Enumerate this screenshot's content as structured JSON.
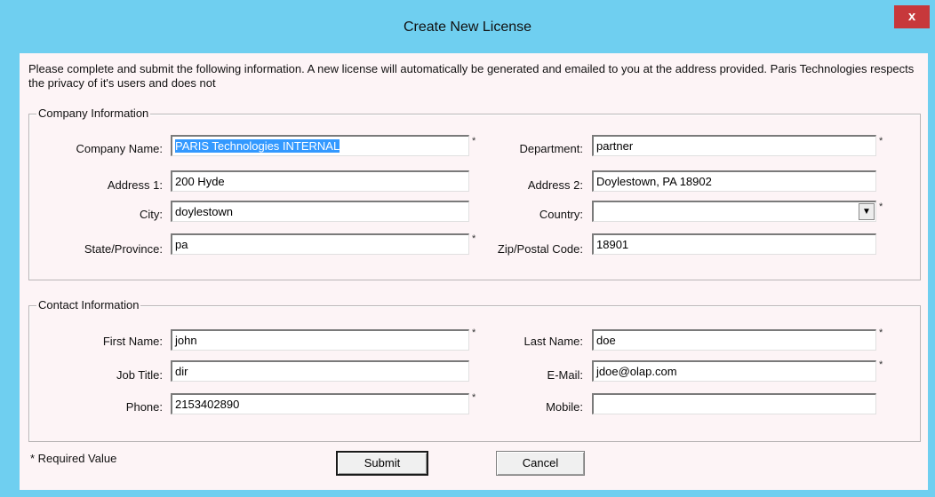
{
  "window": {
    "title": "Create New License",
    "close_label": "x"
  },
  "intro_text": "Please complete and submit the following information.  A new license will automatically be generated and emailed to you at the address provided.  Paris Technologies respects the privacy of it's users and does not",
  "company": {
    "group_title": "Company Information",
    "company_name": {
      "label": "Company Name:",
      "value": "PARIS Technologies INTERNAL"
    },
    "department": {
      "label": "Department:",
      "value": "partner"
    },
    "address1": {
      "label": "Address 1:",
      "value": "200 Hyde"
    },
    "address2": {
      "label": "Address 2:",
      "value": "Doylestown, PA 18902"
    },
    "city": {
      "label": "City:",
      "value": "doylestown"
    },
    "country": {
      "label": "Country:",
      "value": ""
    },
    "state": {
      "label": "State/Province:",
      "value": "pa"
    },
    "zip": {
      "label": "Zip/Postal Code:",
      "value": "18901"
    }
  },
  "contact": {
    "group_title": "Contact Information",
    "first_name": {
      "label": "First Name:",
      "value": "john"
    },
    "last_name": {
      "label": "Last Name:",
      "value": "doe"
    },
    "job_title": {
      "label": "Job Title:",
      "value": "dir"
    },
    "email": {
      "label": "E-Mail:",
      "value": "jdoe@olap.com"
    },
    "phone": {
      "label": "Phone:",
      "value": "2153402890"
    },
    "mobile": {
      "label": "Mobile:",
      "value": ""
    }
  },
  "required_marker": "*",
  "required_note": "* Required Value",
  "buttons": {
    "submit": "Submit",
    "cancel": "Cancel"
  },
  "colors": {
    "titlebar": "#6fcff0",
    "close": "#c7383b",
    "dialog": "#fdf4f6",
    "selection": "#3399ff"
  },
  "icons": {
    "close": "close-icon",
    "dropdown": "chevron-down-icon"
  }
}
